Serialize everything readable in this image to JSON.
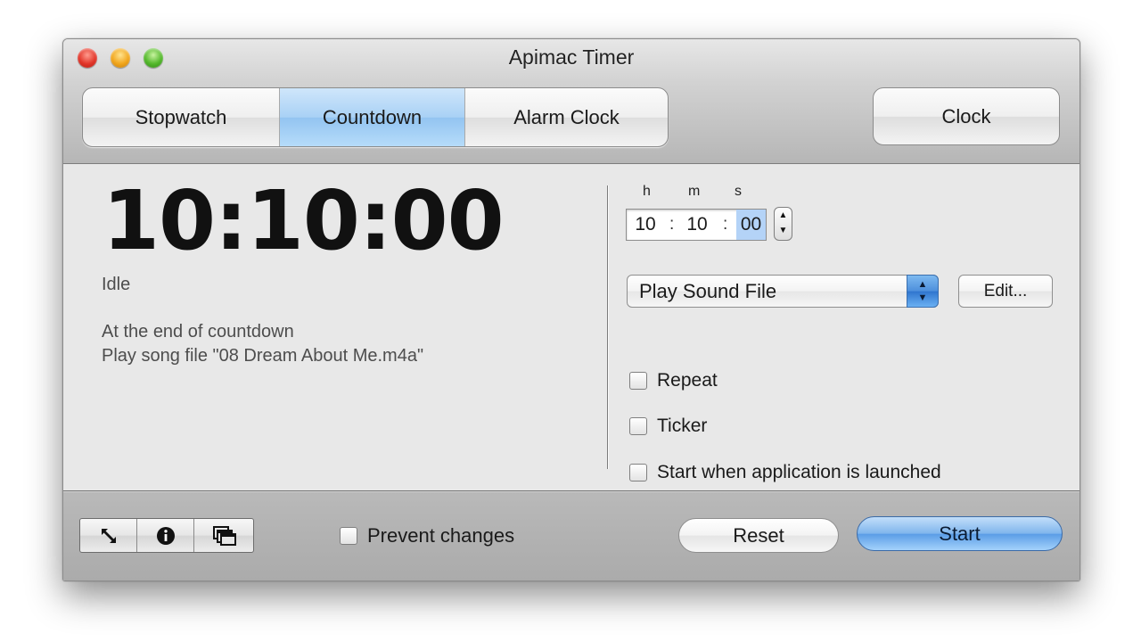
{
  "window": {
    "title": "Apimac Timer"
  },
  "tabs": [
    {
      "label": "Stopwatch"
    },
    {
      "label": "Countdown"
    },
    {
      "label": "Alarm Clock"
    }
  ],
  "tabs_selected": "Countdown",
  "clock_button_label": "Clock",
  "display": {
    "time": "10:10:00",
    "status": "Idle",
    "end_label": "At the end of countdown",
    "end_action": "Play song file \"08 Dream About Me.m4a\""
  },
  "time_input": {
    "h_label": "h",
    "m_label": "m",
    "s_label": "s",
    "hours": "10",
    "minutes": "10",
    "seconds": "00",
    "separator": ":"
  },
  "action_popup": {
    "value": "Play Sound File",
    "edit_label": "Edit..."
  },
  "options": {
    "repeat": {
      "label": "Repeat",
      "checked": false
    },
    "ticker": {
      "label": "Ticker",
      "checked": false
    },
    "start_on_launch": {
      "label": "Start when application is launched",
      "checked": false
    }
  },
  "bottom": {
    "icons": [
      "resize-icon",
      "info-icon",
      "windows-icon"
    ],
    "prevent_changes": {
      "label": "Prevent changes",
      "checked": false
    },
    "reset_label": "Reset",
    "start_label": "Start"
  },
  "colors": {
    "selected_tab": "#a9d1f5",
    "start_button": "#7fb5ec",
    "popup_arrow": "#4d8fdc",
    "close": "#e2372b",
    "minimize": "#f1a61d",
    "zoom": "#54b82c"
  }
}
